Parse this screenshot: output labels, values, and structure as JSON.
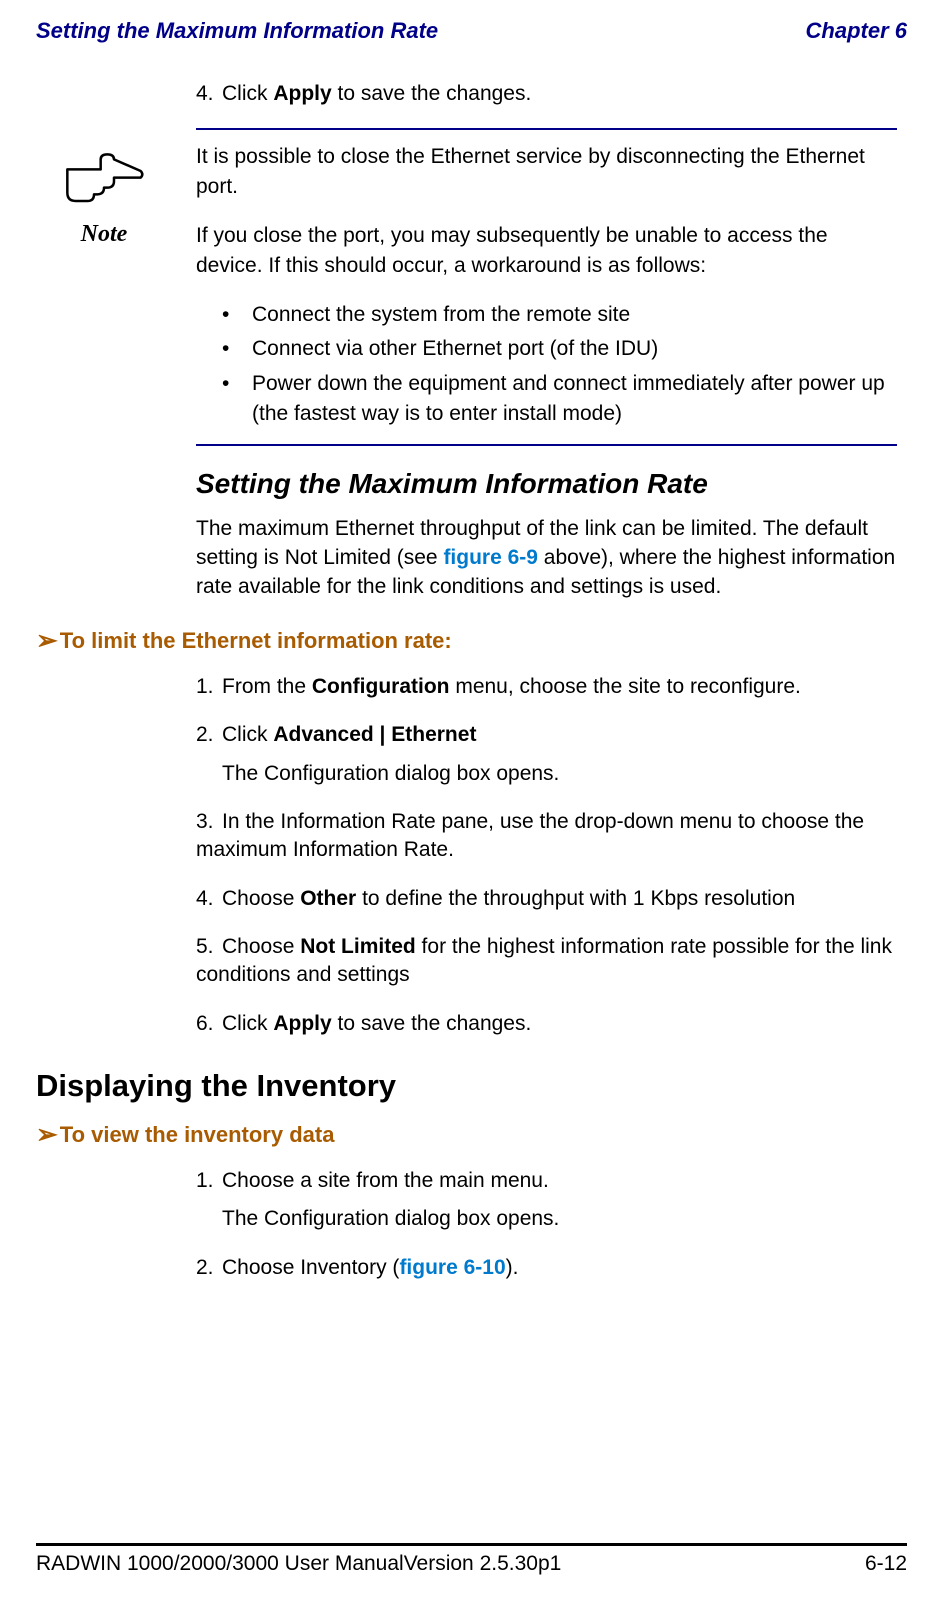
{
  "header": {
    "left": "Setting the Maximum Information Rate",
    "right": "Chapter 6"
  },
  "intro_step": {
    "num": "4.",
    "text_pre": "Click ",
    "bold": "Apply",
    "text_post": " to save the changes."
  },
  "note": {
    "label": "Note",
    "p1": "It is possible to close the Ethernet service by disconnecting the Ethernet port.",
    "p2": "If you close the port, you may subsequently be unable to access the device. If this should occur, a workaround is as follows:",
    "bullets": [
      "Connect the system from the remote site",
      "Connect via other Ethernet port (of the IDU)",
      "Power down the equipment and connect immediately after power up (the fastest way is to enter install mode)"
    ]
  },
  "section1": {
    "title": "Setting the Maximum Information Rate",
    "para_pre": "The maximum Ethernet throughput of the link can be limited. The default setting is Not Limited (see ",
    "para_link": "figure 6-9",
    "para_post": " above), where the highest information rate available for the link conditions and settings is used."
  },
  "proc1": {
    "heading": "To limit the Ethernet information rate:",
    "steps": {
      "s1": {
        "num": "1.",
        "pre": "From the ",
        "b1": "Configuration",
        "post": " menu, choose the site to reconfigure."
      },
      "s2": {
        "num": "2.",
        "pre": "Click ",
        "b1": "Advanced | Ethernet",
        "post": "",
        "sub": "The Configuration dialog box opens."
      },
      "s3": {
        "num": "3.",
        "text": "In the Information Rate pane, use the drop-down menu to choose the maximum Information Rate."
      },
      "s4": {
        "num": "4.",
        "pre": "Choose ",
        "b1": "Other",
        "post": " to define the throughput with 1 Kbps resolution"
      },
      "s5": {
        "num": "5.",
        "pre": "Choose ",
        "b1": "Not Limited",
        "post": " for the highest information rate possible for the link conditions and settings"
      },
      "s6": {
        "num": "6.",
        "pre": "Click ",
        "b1": "Apply",
        "post": " to save the changes."
      }
    }
  },
  "h1": "Displaying the Inventory",
  "proc2": {
    "heading": "To view the inventory data",
    "steps": {
      "s1": {
        "num": "1.",
        "text": "Choose a site from the main menu.",
        "sub": "The Configuration dialog box opens."
      },
      "s2": {
        "num": "2.",
        "pre": "Choose Inventory (",
        "link": "figure 6-10",
        "post": ")."
      }
    }
  },
  "footer": {
    "left": "RADWIN 1000/2000/3000 User ManualVersion  2.5.30p1",
    "right": "6-12"
  }
}
